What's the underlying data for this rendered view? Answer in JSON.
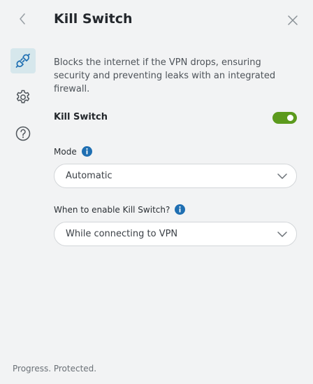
{
  "header": {
    "title": "Kill Switch",
    "back_icon": "chevron-left-icon",
    "close_icon": "close-icon"
  },
  "rail": {
    "items": [
      {
        "icon": "plug-icon",
        "active": true
      },
      {
        "icon": "gear-icon",
        "active": false
      },
      {
        "icon": "help-circle-icon",
        "active": false
      }
    ]
  },
  "main": {
    "description": "Blocks the internet if the VPN drops, ensuring security and preventing leaks with an integrated firewall.",
    "kill_switch": {
      "label": "Kill Switch",
      "enabled": true
    },
    "mode": {
      "label": "Mode",
      "value": "Automatic"
    },
    "when": {
      "label": "When to enable Kill Switch?",
      "value": "While connecting to VPN"
    }
  },
  "footer": {
    "tagline": "Progress. Protected."
  },
  "colors": {
    "accent": "#5c9a1d",
    "info": "#1f6fb2",
    "active_rail_bg": "#d6e7ec",
    "background": "#f2f3f4"
  }
}
